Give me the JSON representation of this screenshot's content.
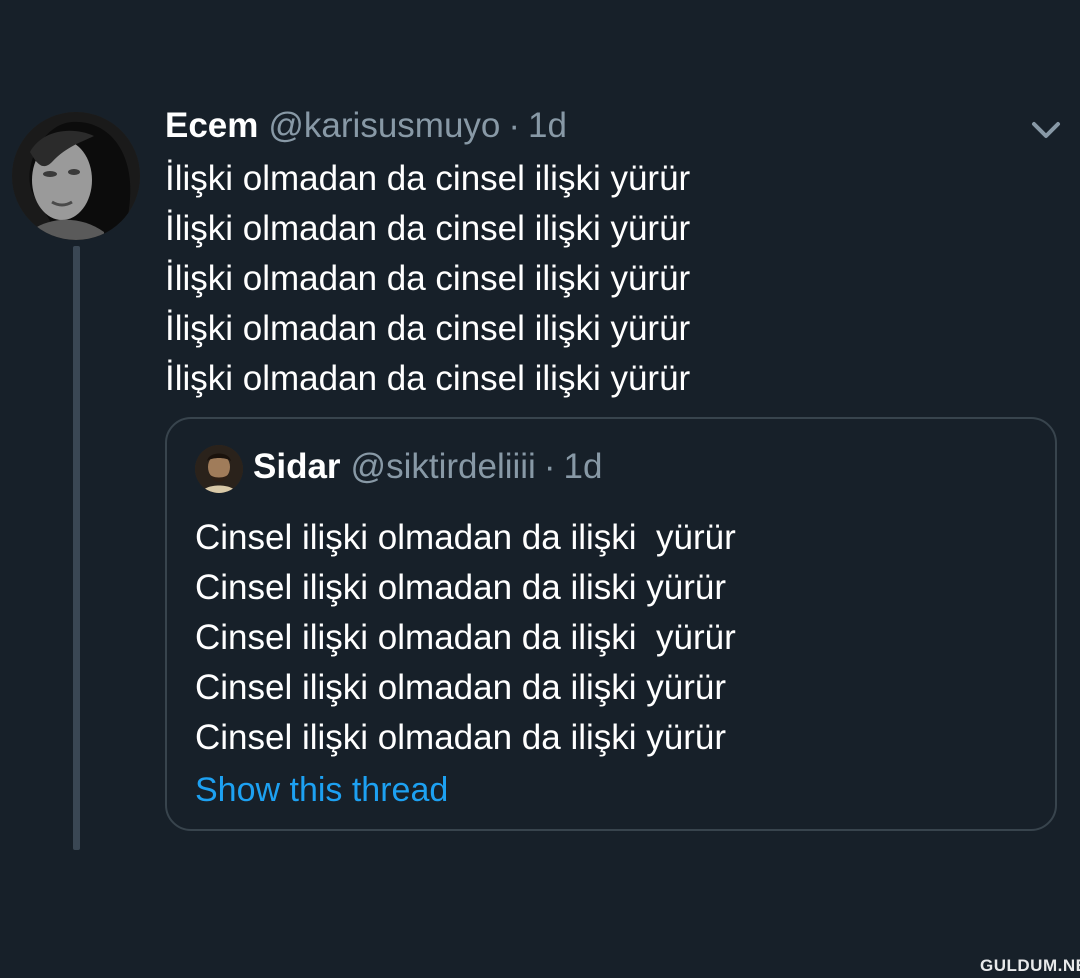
{
  "tweet": {
    "display_name": "Ecem",
    "handle": "@karisusmuyo",
    "separator": "·",
    "time": "1d",
    "lines": [
      "İlişki olmadan da cinsel ilişki yürür",
      "İlişki olmadan da cinsel ilişki yürür",
      "İlişki olmadan da cinsel ilişki yürür",
      "İlişki olmadan da cinsel ilişki yürür",
      "İlişki olmadan da cinsel ilişki yürür"
    ],
    "menu_icon": "chevron-down-icon"
  },
  "quote": {
    "display_name": "Sidar",
    "handle": "@siktirdeliiii",
    "separator": "·",
    "time": "1d",
    "lines": [
      "Cinsel ilişki olmadan da ilişki  yürür",
      "Cinsel ilişki olmadan da iliski yürür",
      "Cinsel ilişki olmadan da ilişki  yürür",
      "Cinsel ilişki olmadan da ilişki yürür",
      "Cinsel ilişki olmadan da ilişki yürür"
    ],
    "show_thread": "Show this thread"
  },
  "watermark": "GULDUM.NET",
  "colors": {
    "background": "#172029",
    "text": "#ffffff",
    "secondary": "#8899a6",
    "link": "#1da1f2",
    "border": "#38444d"
  }
}
